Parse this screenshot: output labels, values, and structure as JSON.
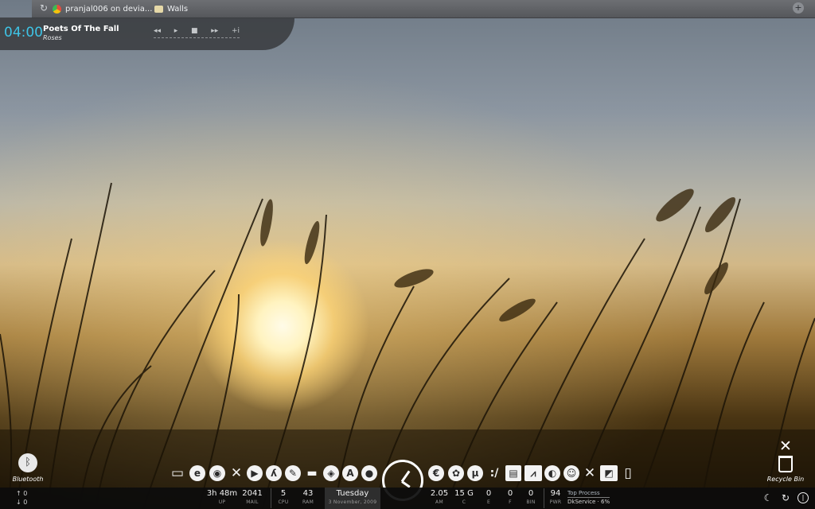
{
  "topbar": {
    "tabs": [
      {
        "label": "pranjal006 on devia...",
        "icon": "globe-icon"
      },
      {
        "label": "Walls",
        "icon": "folder-icon"
      }
    ]
  },
  "music": {
    "time": "04:00",
    "song": "Poets Of The Fall",
    "artist": "Roses",
    "controls": [
      "◂◂",
      "▸",
      "■",
      "▸▸",
      "+i"
    ]
  },
  "desktop": {
    "bluetooth_label": "Bluetooth",
    "recycle_label": "Recycle Bin"
  },
  "dock": {
    "left_icons": [
      "monitor-icon",
      "ie-icon",
      "chrome-icon",
      "tools-icon",
      "media-player-icon",
      "run-icon",
      "pen-icon",
      "controller-icon",
      "gamepad-icon",
      "avast-icon",
      "bomb-icon"
    ],
    "right_icons": [
      "euro-icon",
      "paw-icon",
      "torrent-icon",
      "edit-icon",
      "notepad-icon",
      "graph-icon",
      "car-icon",
      "smiley-icon",
      "tools-icon",
      "sketch-icon",
      "trash-icon"
    ]
  },
  "sysbar": {
    "net": {
      "up": "0",
      "down": "0"
    },
    "uptime": {
      "value": "3h 48m",
      "key": "UP"
    },
    "mail": {
      "value": "2041",
      "key": "MAIL"
    },
    "cpu": {
      "value": "5",
      "key": "CPU"
    },
    "ram": {
      "value": "43",
      "key": "RAM"
    },
    "date": {
      "day": "Tuesday",
      "full": "3 November, 2009"
    },
    "clock": {
      "value": "2.05",
      "key": "AM"
    },
    "drive_c": {
      "value": "15 G",
      "key": "C"
    },
    "drive_e": {
      "value": "0",
      "key": "E"
    },
    "drive_f": {
      "value": "0",
      "key": "F"
    },
    "bin": {
      "value": "0",
      "key": "BIN"
    },
    "power": {
      "value": "94",
      "key": "PWR"
    },
    "top_process": {
      "title": "Top Process",
      "value": "DkService · 6%"
    }
  }
}
